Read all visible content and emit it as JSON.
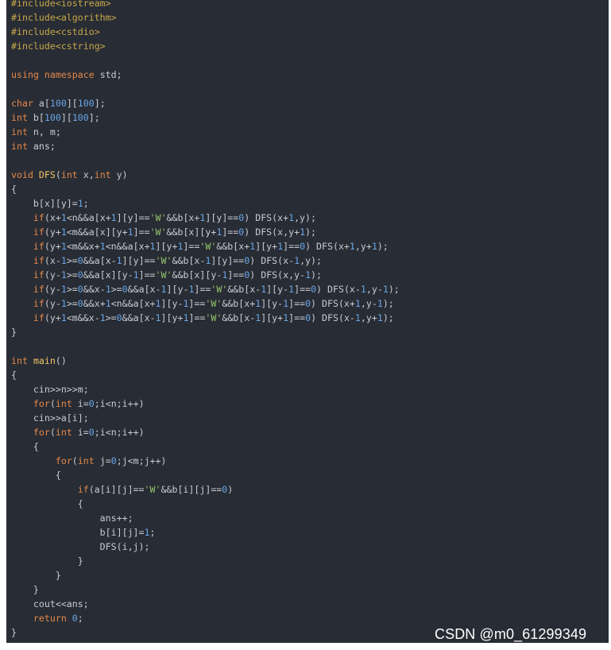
{
  "code": {
    "lines": [
      [
        {
          "t": "#include<iostream>",
          "c": "pp"
        }
      ],
      [
        {
          "t": "#include<algorithm>",
          "c": "pp"
        }
      ],
      [
        {
          "t": "#include<cstdio>",
          "c": "pp"
        }
      ],
      [
        {
          "t": "#include<cstring>",
          "c": "pp"
        }
      ],
      [],
      [
        {
          "t": "using",
          "c": "kw"
        },
        {
          "t": " ",
          "c": ""
        },
        {
          "t": "namespace",
          "c": "kw"
        },
        {
          "t": " std;",
          "c": "id"
        }
      ],
      [],
      [
        {
          "t": "char",
          "c": "ty"
        },
        {
          "t": " a[",
          "c": "id"
        },
        {
          "t": "100",
          "c": "nm"
        },
        {
          "t": "][",
          "c": "id"
        },
        {
          "t": "100",
          "c": "nm"
        },
        {
          "t": "];",
          "c": "id"
        }
      ],
      [
        {
          "t": "int",
          "c": "ty"
        },
        {
          "t": " b[",
          "c": "id"
        },
        {
          "t": "100",
          "c": "nm"
        },
        {
          "t": "][",
          "c": "id"
        },
        {
          "t": "100",
          "c": "nm"
        },
        {
          "t": "];",
          "c": "id"
        }
      ],
      [
        {
          "t": "int",
          "c": "ty"
        },
        {
          "t": " n, m;",
          "c": "id"
        }
      ],
      [
        {
          "t": "int",
          "c": "ty"
        },
        {
          "t": " ans;",
          "c": "id"
        }
      ],
      [],
      [
        {
          "t": "void",
          "c": "ty"
        },
        {
          "t": " ",
          "c": ""
        },
        {
          "t": "DFS",
          "c": "fn"
        },
        {
          "t": "(",
          "c": "id"
        },
        {
          "t": "int",
          "c": "ty"
        },
        {
          "t": " x,",
          "c": "id"
        },
        {
          "t": "int",
          "c": "ty"
        },
        {
          "t": " y)",
          "c": "id"
        }
      ],
      [
        {
          "t": "{",
          "c": "id"
        }
      ],
      [
        {
          "t": "    b[x][y]=",
          "c": "id"
        },
        {
          "t": "1",
          "c": "nm"
        },
        {
          "t": ";",
          "c": "id"
        }
      ],
      [
        {
          "t": "    ",
          "c": ""
        },
        {
          "t": "if",
          "c": "kw"
        },
        {
          "t": "(x+",
          "c": "id"
        },
        {
          "t": "1",
          "c": "nm"
        },
        {
          "t": "<n&&a[x+",
          "c": "id"
        },
        {
          "t": "1",
          "c": "nm"
        },
        {
          "t": "][y]==",
          "c": "id"
        },
        {
          "t": "'W'",
          "c": "st"
        },
        {
          "t": "&&b[x+",
          "c": "id"
        },
        {
          "t": "1",
          "c": "nm"
        },
        {
          "t": "][y]==",
          "c": "id"
        },
        {
          "t": "0",
          "c": "nm"
        },
        {
          "t": ") DFS(x+",
          "c": "id"
        },
        {
          "t": "1",
          "c": "nm"
        },
        {
          "t": ",y);",
          "c": "id"
        }
      ],
      [
        {
          "t": "    ",
          "c": ""
        },
        {
          "t": "if",
          "c": "kw"
        },
        {
          "t": "(y+",
          "c": "id"
        },
        {
          "t": "1",
          "c": "nm"
        },
        {
          "t": "<m&&a[x][y+",
          "c": "id"
        },
        {
          "t": "1",
          "c": "nm"
        },
        {
          "t": "]==",
          "c": "id"
        },
        {
          "t": "'W'",
          "c": "st"
        },
        {
          "t": "&&b[x][y+",
          "c": "id"
        },
        {
          "t": "1",
          "c": "nm"
        },
        {
          "t": "]==",
          "c": "id"
        },
        {
          "t": "0",
          "c": "nm"
        },
        {
          "t": ") DFS(x,y+",
          "c": "id"
        },
        {
          "t": "1",
          "c": "nm"
        },
        {
          "t": ");",
          "c": "id"
        }
      ],
      [
        {
          "t": "    ",
          "c": ""
        },
        {
          "t": "if",
          "c": "kw"
        },
        {
          "t": "(y+",
          "c": "id"
        },
        {
          "t": "1",
          "c": "nm"
        },
        {
          "t": "<m&&x+",
          "c": "id"
        },
        {
          "t": "1",
          "c": "nm"
        },
        {
          "t": "<n&&a[x+",
          "c": "id"
        },
        {
          "t": "1",
          "c": "nm"
        },
        {
          "t": "][y+",
          "c": "id"
        },
        {
          "t": "1",
          "c": "nm"
        },
        {
          "t": "]==",
          "c": "id"
        },
        {
          "t": "'W'",
          "c": "st"
        },
        {
          "t": "&&b[x+",
          "c": "id"
        },
        {
          "t": "1",
          "c": "nm"
        },
        {
          "t": "][y+",
          "c": "id"
        },
        {
          "t": "1",
          "c": "nm"
        },
        {
          "t": "]==",
          "c": "id"
        },
        {
          "t": "0",
          "c": "nm"
        },
        {
          "t": ") DFS(x+",
          "c": "id"
        },
        {
          "t": "1",
          "c": "nm"
        },
        {
          "t": ",y+",
          "c": "id"
        },
        {
          "t": "1",
          "c": "nm"
        },
        {
          "t": ");",
          "c": "id"
        }
      ],
      [
        {
          "t": "    ",
          "c": ""
        },
        {
          "t": "if",
          "c": "kw"
        },
        {
          "t": "(x-",
          "c": "id"
        },
        {
          "t": "1",
          "c": "nm"
        },
        {
          "t": ">=",
          "c": "id"
        },
        {
          "t": "0",
          "c": "nm"
        },
        {
          "t": "&&a[x-",
          "c": "id"
        },
        {
          "t": "1",
          "c": "nm"
        },
        {
          "t": "][y]==",
          "c": "id"
        },
        {
          "t": "'W'",
          "c": "st"
        },
        {
          "t": "&&b[x-",
          "c": "id"
        },
        {
          "t": "1",
          "c": "nm"
        },
        {
          "t": "][y]==",
          "c": "id"
        },
        {
          "t": "0",
          "c": "nm"
        },
        {
          "t": ") DFS(x-",
          "c": "id"
        },
        {
          "t": "1",
          "c": "nm"
        },
        {
          "t": ",y);",
          "c": "id"
        }
      ],
      [
        {
          "t": "    ",
          "c": ""
        },
        {
          "t": "if",
          "c": "kw"
        },
        {
          "t": "(y-",
          "c": "id"
        },
        {
          "t": "1",
          "c": "nm"
        },
        {
          "t": ">=",
          "c": "id"
        },
        {
          "t": "0",
          "c": "nm"
        },
        {
          "t": "&&a[x][y-",
          "c": "id"
        },
        {
          "t": "1",
          "c": "nm"
        },
        {
          "t": "]==",
          "c": "id"
        },
        {
          "t": "'W'",
          "c": "st"
        },
        {
          "t": "&&b[x][y-",
          "c": "id"
        },
        {
          "t": "1",
          "c": "nm"
        },
        {
          "t": "]==",
          "c": "id"
        },
        {
          "t": "0",
          "c": "nm"
        },
        {
          "t": ") DFS(x,y-",
          "c": "id"
        },
        {
          "t": "1",
          "c": "nm"
        },
        {
          "t": ");",
          "c": "id"
        }
      ],
      [
        {
          "t": "    ",
          "c": ""
        },
        {
          "t": "if",
          "c": "kw"
        },
        {
          "t": "(y-",
          "c": "id"
        },
        {
          "t": "1",
          "c": "nm"
        },
        {
          "t": ">=",
          "c": "id"
        },
        {
          "t": "0",
          "c": "nm"
        },
        {
          "t": "&&x-",
          "c": "id"
        },
        {
          "t": "1",
          "c": "nm"
        },
        {
          "t": ">=",
          "c": "id"
        },
        {
          "t": "0",
          "c": "nm"
        },
        {
          "t": "&&a[x-",
          "c": "id"
        },
        {
          "t": "1",
          "c": "nm"
        },
        {
          "t": "][y-",
          "c": "id"
        },
        {
          "t": "1",
          "c": "nm"
        },
        {
          "t": "]==",
          "c": "id"
        },
        {
          "t": "'W'",
          "c": "st"
        },
        {
          "t": "&&b[x-",
          "c": "id"
        },
        {
          "t": "1",
          "c": "nm"
        },
        {
          "t": "][y-",
          "c": "id"
        },
        {
          "t": "1",
          "c": "nm"
        },
        {
          "t": "]==",
          "c": "id"
        },
        {
          "t": "0",
          "c": "nm"
        },
        {
          "t": ") DFS(x-",
          "c": "id"
        },
        {
          "t": "1",
          "c": "nm"
        },
        {
          "t": ",y-",
          "c": "id"
        },
        {
          "t": "1",
          "c": "nm"
        },
        {
          "t": ");",
          "c": "id"
        }
      ],
      [
        {
          "t": "    ",
          "c": ""
        },
        {
          "t": "if",
          "c": "kw"
        },
        {
          "t": "(y-",
          "c": "id"
        },
        {
          "t": "1",
          "c": "nm"
        },
        {
          "t": ">=",
          "c": "id"
        },
        {
          "t": "0",
          "c": "nm"
        },
        {
          "t": "&&x+",
          "c": "id"
        },
        {
          "t": "1",
          "c": "nm"
        },
        {
          "t": "<n&&a[x+",
          "c": "id"
        },
        {
          "t": "1",
          "c": "nm"
        },
        {
          "t": "][y-",
          "c": "id"
        },
        {
          "t": "1",
          "c": "nm"
        },
        {
          "t": "]==",
          "c": "id"
        },
        {
          "t": "'W'",
          "c": "st"
        },
        {
          "t": "&&b[x+",
          "c": "id"
        },
        {
          "t": "1",
          "c": "nm"
        },
        {
          "t": "][y-",
          "c": "id"
        },
        {
          "t": "1",
          "c": "nm"
        },
        {
          "t": "]==",
          "c": "id"
        },
        {
          "t": "0",
          "c": "nm"
        },
        {
          "t": ") DFS(x+",
          "c": "id"
        },
        {
          "t": "1",
          "c": "nm"
        },
        {
          "t": ",y-",
          "c": "id"
        },
        {
          "t": "1",
          "c": "nm"
        },
        {
          "t": ");",
          "c": "id"
        }
      ],
      [
        {
          "t": "    ",
          "c": ""
        },
        {
          "t": "if",
          "c": "kw"
        },
        {
          "t": "(y+",
          "c": "id"
        },
        {
          "t": "1",
          "c": "nm"
        },
        {
          "t": "<m&&x-",
          "c": "id"
        },
        {
          "t": "1",
          "c": "nm"
        },
        {
          "t": ">=",
          "c": "id"
        },
        {
          "t": "0",
          "c": "nm"
        },
        {
          "t": "&&a[x-",
          "c": "id"
        },
        {
          "t": "1",
          "c": "nm"
        },
        {
          "t": "][y+",
          "c": "id"
        },
        {
          "t": "1",
          "c": "nm"
        },
        {
          "t": "]==",
          "c": "id"
        },
        {
          "t": "'W'",
          "c": "st"
        },
        {
          "t": "&&b[x-",
          "c": "id"
        },
        {
          "t": "1",
          "c": "nm"
        },
        {
          "t": "][y+",
          "c": "id"
        },
        {
          "t": "1",
          "c": "nm"
        },
        {
          "t": "]==",
          "c": "id"
        },
        {
          "t": "0",
          "c": "nm"
        },
        {
          "t": ") DFS(x-",
          "c": "id"
        },
        {
          "t": "1",
          "c": "nm"
        },
        {
          "t": ",y+",
          "c": "id"
        },
        {
          "t": "1",
          "c": "nm"
        },
        {
          "t": ");",
          "c": "id"
        }
      ],
      [
        {
          "t": "}",
          "c": "id"
        }
      ],
      [],
      [
        {
          "t": "int",
          "c": "ty"
        },
        {
          "t": " ",
          "c": ""
        },
        {
          "t": "main",
          "c": "fn"
        },
        {
          "t": "()",
          "c": "id"
        }
      ],
      [
        {
          "t": "{",
          "c": "id"
        }
      ],
      [
        {
          "t": "    cin>>n>>m;",
          "c": "id"
        }
      ],
      [
        {
          "t": "    ",
          "c": ""
        },
        {
          "t": "for",
          "c": "kw"
        },
        {
          "t": "(",
          "c": "id"
        },
        {
          "t": "int",
          "c": "ty"
        },
        {
          "t": " i=",
          "c": "id"
        },
        {
          "t": "0",
          "c": "nm"
        },
        {
          "t": ";i<n;i++)",
          "c": "id"
        }
      ],
      [
        {
          "t": "    cin>>a[i];",
          "c": "id"
        }
      ],
      [
        {
          "t": "    ",
          "c": ""
        },
        {
          "t": "for",
          "c": "kw"
        },
        {
          "t": "(",
          "c": "id"
        },
        {
          "t": "int",
          "c": "ty"
        },
        {
          "t": " i=",
          "c": "id"
        },
        {
          "t": "0",
          "c": "nm"
        },
        {
          "t": ";i<n;i++)",
          "c": "id"
        }
      ],
      [
        {
          "t": "    {",
          "c": "id"
        }
      ],
      [
        {
          "t": "        ",
          "c": ""
        },
        {
          "t": "for",
          "c": "kw"
        },
        {
          "t": "(",
          "c": "id"
        },
        {
          "t": "int",
          "c": "ty"
        },
        {
          "t": " j=",
          "c": "id"
        },
        {
          "t": "0",
          "c": "nm"
        },
        {
          "t": ";j<m;j++)",
          "c": "id"
        }
      ],
      [
        {
          "t": "        {",
          "c": "id"
        }
      ],
      [
        {
          "t": "            ",
          "c": ""
        },
        {
          "t": "if",
          "c": "kw"
        },
        {
          "t": "(a[i][j]==",
          "c": "id"
        },
        {
          "t": "'W'",
          "c": "st"
        },
        {
          "t": "&&b[i][j]==",
          "c": "id"
        },
        {
          "t": "0",
          "c": "nm"
        },
        {
          "t": ")",
          "c": "id"
        }
      ],
      [
        {
          "t": "            {",
          "c": "id"
        }
      ],
      [
        {
          "t": "                ans++;",
          "c": "id"
        }
      ],
      [
        {
          "t": "                b[i][j]=",
          "c": "id"
        },
        {
          "t": "1",
          "c": "nm"
        },
        {
          "t": ";",
          "c": "id"
        }
      ],
      [
        {
          "t": "                DFS(i,j);",
          "c": "id"
        }
      ],
      [
        {
          "t": "            }",
          "c": "id"
        }
      ],
      [
        {
          "t": "        }",
          "c": "id"
        }
      ],
      [
        {
          "t": "    }",
          "c": "id"
        }
      ],
      [
        {
          "t": "    cout<<ans;",
          "c": "id"
        }
      ],
      [
        {
          "t": "    ",
          "c": ""
        },
        {
          "t": "return",
          "c": "kw"
        },
        {
          "t": " ",
          "c": ""
        },
        {
          "t": "0",
          "c": "nm"
        },
        {
          "t": ";",
          "c": "id"
        }
      ],
      [
        {
          "t": "}",
          "c": "id"
        }
      ]
    ]
  },
  "watermark": "CSDN @m0_61299349",
  "colors": {
    "background": "#282c34",
    "preprocessor": "#c8a84b",
    "keyword": "#e5884a",
    "function": "#f0c566",
    "number": "#6aa6e8",
    "string": "#96c66d",
    "identifier": "#c9ccd1"
  }
}
